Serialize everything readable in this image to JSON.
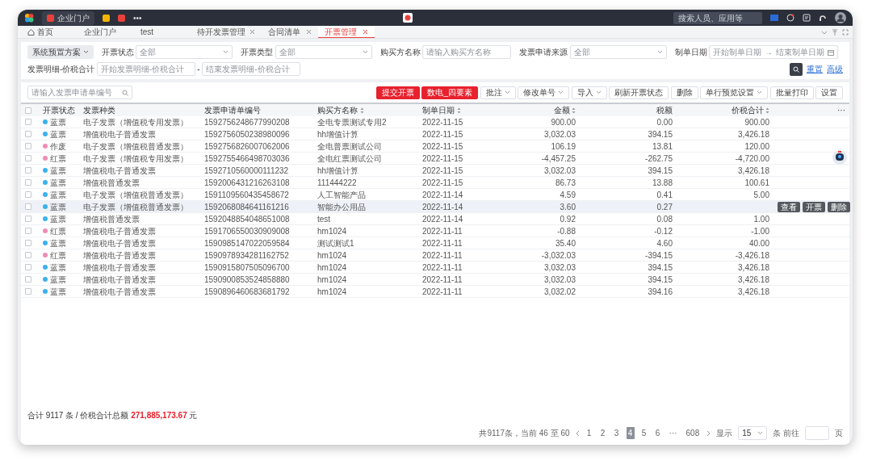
{
  "top_bar": {
    "apps": [
      {
        "kind": "tab",
        "label": "企业门户",
        "color": "#e8413c"
      },
      {
        "kind": "icon",
        "color": "#f5b400"
      },
      {
        "kind": "icon",
        "color": "#e8413c"
      },
      {
        "kind": "more",
        "label": "•••"
      }
    ],
    "search": {
      "placeholder": "搜索人员、应用等"
    }
  },
  "page_tabs": [
    {
      "label": "首页",
      "home": true,
      "closable": false,
      "selected": false
    },
    {
      "label": "企业门户",
      "home": false,
      "closable": false,
      "selected": false
    },
    {
      "label": "test",
      "home": false,
      "closable": false,
      "selected": false
    },
    {
      "label": "待开发票管理",
      "home": false,
      "closable": true,
      "selected": false
    },
    {
      "label": "合同清单",
      "home": false,
      "closable": true,
      "selected": false
    },
    {
      "label": "开票管理",
      "home": false,
      "closable": true,
      "selected": true
    }
  ],
  "filters": {
    "scheme": "系统预置方案",
    "fields": [
      {
        "kind": "select",
        "label": "开票状态",
        "placeholder": "全部"
      },
      {
        "kind": "select",
        "label": "开票类型",
        "placeholder": "全部"
      },
      {
        "kind": "text",
        "label": "购买方名称",
        "placeholder": "请输入购买方名称"
      },
      {
        "kind": "select",
        "label": "发票申请来源",
        "placeholder": "全部"
      },
      {
        "kind": "date_range",
        "label": "制单日期",
        "from": {
          "placeholder": "开始制单日期"
        },
        "separator": "→",
        "to": {
          "placeholder": "结束制单日期"
        }
      },
      {
        "kind": "number_range",
        "label": "发票明细-价税合计",
        "from": {
          "placeholder": "开始发票明细-价税合计"
        },
        "separator": "-",
        "to": {
          "placeholder": "结束发票明细-价税合计"
        }
      }
    ],
    "links": [
      "重置",
      "高级"
    ]
  },
  "toolbar": {
    "search": {
      "placeholder": "请输入发票申请单编号"
    },
    "buttons": [
      {
        "label": "提交开票",
        "kind": "primary",
        "dropdown": false
      },
      {
        "label": "数电_四要素",
        "kind": "primary",
        "dropdown": false
      },
      {
        "label": "批注",
        "kind": "default",
        "dropdown": true
      },
      {
        "label": "修改单号",
        "kind": "default",
        "dropdown": true
      },
      {
        "label": "导入",
        "kind": "default",
        "dropdown": true
      },
      {
        "label": "刷新开票状态",
        "kind": "default",
        "dropdown": false
      },
      {
        "label": "删除",
        "kind": "default",
        "dropdown": false
      },
      {
        "label": "单行预览设置",
        "kind": "default",
        "dropdown": true
      },
      {
        "label": "批量打印",
        "kind": "default",
        "dropdown": false
      },
      {
        "label": "设置",
        "kind": "default",
        "dropdown": false
      }
    ]
  },
  "table": {
    "header_checked": false,
    "columns": [
      {
        "label": "开票状态",
        "sortable": false
      },
      {
        "label": "发票种类",
        "sortable": false
      },
      {
        "label": "发票申请单编号",
        "sortable": false
      },
      {
        "label": "购买方名称",
        "sortable": true
      },
      {
        "label": "制单日期",
        "sortable": true
      },
      {
        "label": "金额",
        "sortable": true
      },
      {
        "label": "税额",
        "sortable": false
      },
      {
        "label": "价税合计",
        "sortable": true
      },
      {
        "label": "···",
        "sortable": false
      }
    ],
    "rows": [
      {
        "checked": false,
        "highlighted": false,
        "status": "蓝票",
        "color": "#3cb0f0",
        "type": "电子发票（增值税专用发票）",
        "number": "1592756248677990208",
        "buyer": "全电专票测试专用2",
        "date": "2022-11-15",
        "amount": "900.00",
        "tax": "0.00",
        "total": "900.00"
      },
      {
        "checked": false,
        "highlighted": false,
        "status": "蓝票",
        "color": "#3cb0f0",
        "type": "增值税电子普通发票",
        "number": "1592756050238980096",
        "buyer": "hh增值计算",
        "date": "2022-11-15",
        "amount": "3,032.03",
        "tax": "394.15",
        "total": "3,426.18"
      },
      {
        "checked": false,
        "highlighted": false,
        "status": "作废",
        "color": "#f08cb4",
        "type": "电子发票（增值税普通发票）",
        "number": "1592756826007062006",
        "buyer": "全电普票测试公司",
        "date": "2022-11-15",
        "amount": "106.19",
        "tax": "13.81",
        "total": "120.00"
      },
      {
        "checked": false,
        "highlighted": false,
        "status": "红票",
        "color": "#f08cb4",
        "type": "电子发票（增值税专用发票）",
        "number": "1592755466498703036",
        "buyer": "全电红票测试公司",
        "date": "2022-11-15",
        "amount": "-4,457.25",
        "tax": "-262.75",
        "total": "-4,720.00"
      },
      {
        "checked": false,
        "highlighted": false,
        "status": "蓝票",
        "color": "#3cb0f0",
        "type": "增值税电子普通发票",
        "number": "1592710560000111232",
        "buyer": "hh增值计算",
        "date": "2022-11-15",
        "amount": "3,032.03",
        "tax": "394.15",
        "total": "3,426.18"
      },
      {
        "checked": false,
        "highlighted": false,
        "status": "蓝票",
        "color": "#3cb0f0",
        "type": "增值税普通发票",
        "number": "1592006431216263108",
        "buyer": "111444222",
        "date": "2022-11-15",
        "amount": "86.73",
        "tax": "13.88",
        "total": "100.61"
      },
      {
        "checked": false,
        "highlighted": false,
        "status": "蓝票",
        "color": "#3cb0f0",
        "type": "电子发票（增值税普通发票）",
        "number": "1591109560435458672",
        "buyer": "人工智能产品",
        "date": "2022-11-14",
        "amount": "4.59",
        "tax": "0.41",
        "total": "5.00"
      },
      {
        "checked": false,
        "highlighted": true,
        "status": "蓝票",
        "color": "#3cb0f0",
        "type": "电子发票（增值税普通发票）",
        "number": "1592068084641161216",
        "buyer": "智能办公用品",
        "date": "2022-11-14",
        "amount": "3.60",
        "tax": "0.27",
        "actions": [
          "查看",
          "开票",
          "删除"
        ]
      },
      {
        "checked": false,
        "highlighted": false,
        "status": "蓝票",
        "color": "#3cb0f0",
        "type": "增值税普通发票",
        "number": "1592048854048651008",
        "buyer": "test",
        "date": "2022-11-14",
        "amount": "0.92",
        "tax": "0.08",
        "total": "1.00"
      },
      {
        "checked": false,
        "highlighted": false,
        "status": "红票",
        "color": "#f08cb4",
        "type": "增值税电子普通发票",
        "number": "1591706550030909008",
        "buyer": "hm1024",
        "date": "2022-11-11",
        "amount": "-0.88",
        "tax": "-0.12",
        "total": "-1.00"
      },
      {
        "checked": false,
        "highlighted": false,
        "status": "蓝票",
        "color": "#3cb0f0",
        "type": "增值税电子普通发票",
        "number": "1590985147022059584",
        "buyer": "测试测试1",
        "date": "2022-11-11",
        "amount": "35.40",
        "tax": "4.60",
        "total": "40.00"
      },
      {
        "checked": false,
        "highlighted": false,
        "status": "红票",
        "color": "#f08cb4",
        "type": "增值税电子普通发票",
        "number": "1590978934281162752",
        "buyer": "hm1024",
        "date": "2022-11-11",
        "amount": "-3,032.03",
        "tax": "-394.15",
        "total": "-3,426.18"
      },
      {
        "checked": false,
        "highlighted": false,
        "status": "蓝票",
        "color": "#3cb0f0",
        "type": "增值税电子普通发票",
        "number": "1590915807505096700",
        "buyer": "hm1024",
        "date": "2022-11-11",
        "amount": "3,032.03",
        "tax": "394.15",
        "total": "3,426.18"
      },
      {
        "checked": false,
        "highlighted": false,
        "status": "蓝票",
        "color": "#3cb0f0",
        "type": "增值税电子普通发票",
        "number": "1590900853524858880",
        "buyer": "hm1024",
        "date": "2022-11-11",
        "amount": "3,032.03",
        "tax": "394.15",
        "total": "3,426.18"
      },
      {
        "checked": false,
        "highlighted": false,
        "status": "蓝票",
        "color": "#3cb0f0",
        "type": "增值税电子普通发票",
        "number": "1590896460683681792",
        "buyer": "hm1024",
        "date": "2022-11-11",
        "amount": "3,032.02",
        "tax": "394.16",
        "total": "3,426.18"
      }
    ]
  },
  "summary": {
    "text": "合计 9117 条 / 价税合计总额",
    "amount": "271,885,173.67",
    "unit": "元"
  },
  "pagination": {
    "range": "共9117条，当前 46 至 60",
    "pages": [
      {
        "label": "1",
        "selected": false
      },
      {
        "label": "2",
        "selected": false
      },
      {
        "label": "3",
        "selected": false
      },
      {
        "label": "4",
        "selected": true
      },
      {
        "label": "5",
        "selected": false
      },
      {
        "label": "6",
        "selected": false
      },
      {
        "label": "···",
        "selected": false
      },
      {
        "label": "608",
        "selected": false
      }
    ],
    "show_label": "显示",
    "page_size": "15",
    "goto_label": "条 前往",
    "page_unit": "页"
  }
}
